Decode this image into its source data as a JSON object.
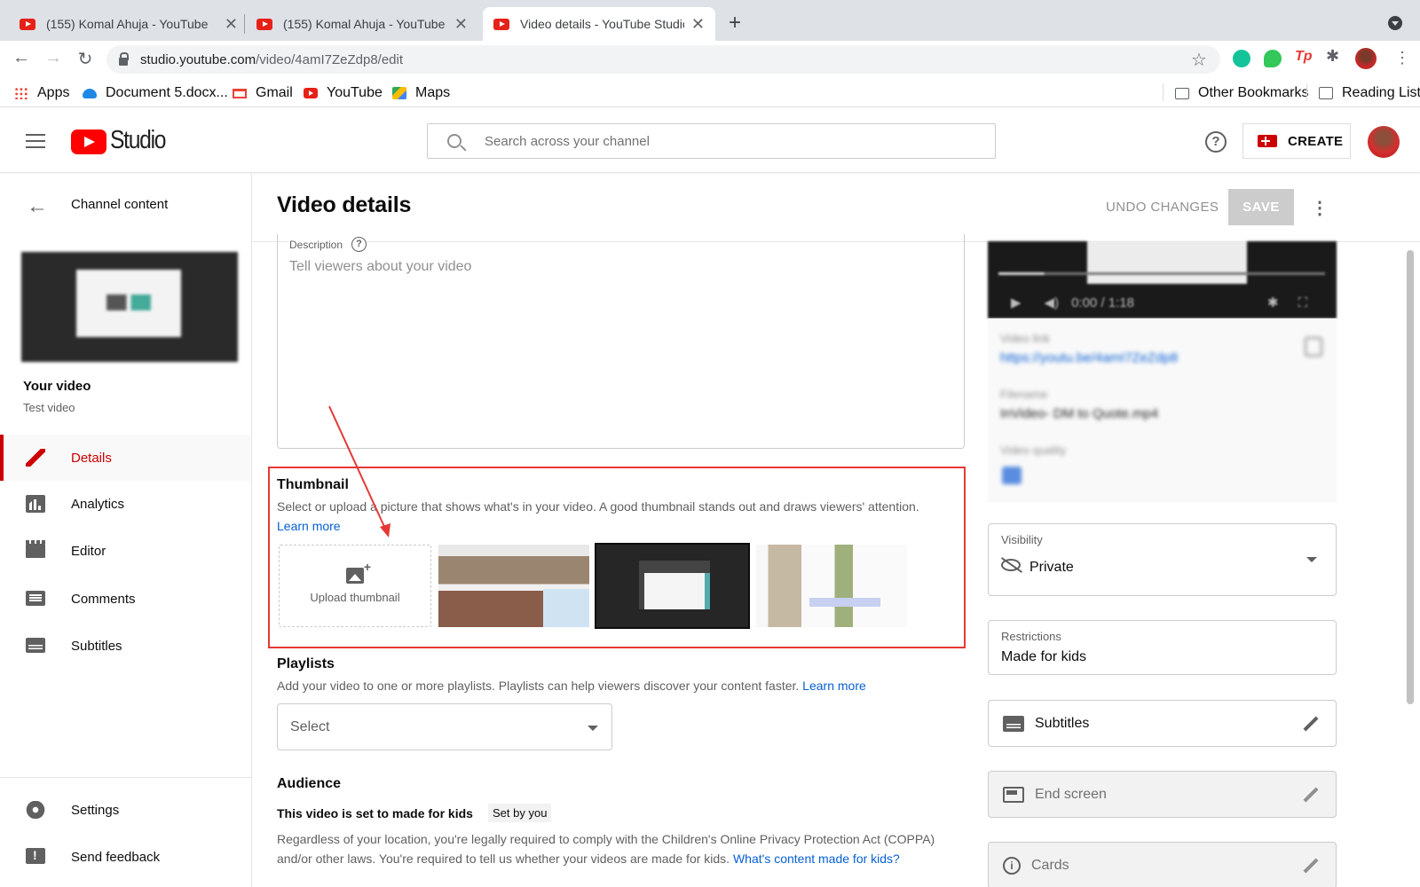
{
  "browser": {
    "tabs": [
      {
        "title": "(155) Komal Ahuja - YouTube"
      },
      {
        "title": "(155) Komal Ahuja - YouTube"
      },
      {
        "title": "Video details - YouTube Studio"
      }
    ],
    "url_host": "studio.youtube.com",
    "url_path": "/video/4amI7ZeZdp8/edit",
    "bookmarks": [
      "Apps",
      "Document 5.docx...",
      "Gmail",
      "YouTube",
      "Maps"
    ],
    "other_bookmarks": "Other Bookmarks",
    "reading_list": "Reading List"
  },
  "header": {
    "logo_text": "Studio",
    "search_placeholder": "Search across your channel",
    "create_label": "CREATE"
  },
  "sidebar": {
    "back_label": "Channel content",
    "your_video_label": "Your video",
    "video_title": "Test video",
    "nav": [
      {
        "label": "Details",
        "icon": "pencil-icon",
        "active": true
      },
      {
        "label": "Analytics",
        "icon": "analytics-icon"
      },
      {
        "label": "Editor",
        "icon": "editor-icon"
      },
      {
        "label": "Comments",
        "icon": "comments-icon"
      },
      {
        "label": "Subtitles",
        "icon": "subtitles-icon"
      }
    ],
    "footer": [
      {
        "label": "Settings",
        "icon": "gear-icon"
      },
      {
        "label": "Send feedback",
        "icon": "feedback-icon"
      }
    ]
  },
  "main": {
    "title": "Video details",
    "undo_label": "UNDO CHANGES",
    "save_label": "SAVE",
    "description": {
      "label": "Description",
      "placeholder": "Tell viewers about your video"
    },
    "thumbnail": {
      "title": "Thumbnail",
      "desc": "Select or upload a picture that shows what's in your video. A good thumbnail stands out and draws viewers' attention.",
      "learn_more": "Learn more",
      "upload_label": "Upload thumbnail"
    },
    "playlists": {
      "title": "Playlists",
      "desc": "Add your video to one or more playlists. Playlists can help viewers discover your content faster.",
      "learn_more": "Learn more",
      "select_label": "Select"
    },
    "audience": {
      "title": "Audience",
      "made_for_kids": "This video is set to made for kids",
      "set_by": "Set by you",
      "coppa": "Regardless of your location, you're legally required to comply with the Children's Online Privacy Protection Act (COPPA) and/or other laws. You're required to tell us whether your videos are made for kids.",
      "coppa_link": "What's content made for kids?"
    }
  },
  "right": {
    "player_time": "0:00 / 1:18",
    "video_link_label": "Video link",
    "video_link": "https://youtu.be/4amI7ZeZdp8",
    "filename_label": "Filename",
    "filename": "InVideo- DM to Quote.mp4",
    "quality_label": "Video quality",
    "visibility_label": "Visibility",
    "visibility_value": "Private",
    "restrictions_label": "Restrictions",
    "restrictions_value": "Made for kids",
    "subtitles_label": "Subtitles",
    "end_screen_label": "End screen",
    "cards_label": "Cards"
  },
  "colors": {
    "accent_red": "#cc0000",
    "link_blue": "#065fd4",
    "annotation_red": "#e53935"
  }
}
